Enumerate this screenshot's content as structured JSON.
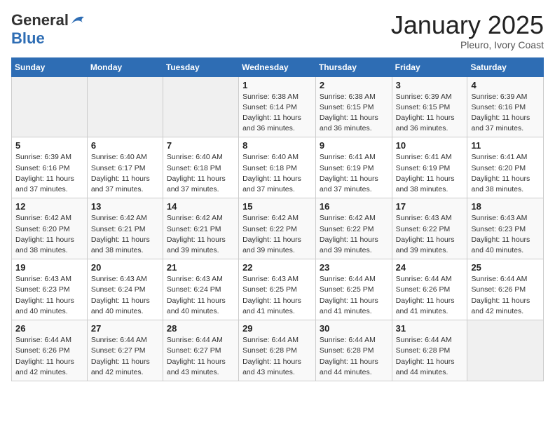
{
  "header": {
    "logo_general": "General",
    "logo_blue": "Blue",
    "month": "January 2025",
    "location": "Pleuro, Ivory Coast"
  },
  "weekdays": [
    "Sunday",
    "Monday",
    "Tuesday",
    "Wednesday",
    "Thursday",
    "Friday",
    "Saturday"
  ],
  "weeks": [
    [
      {
        "day": "",
        "info": ""
      },
      {
        "day": "",
        "info": ""
      },
      {
        "day": "",
        "info": ""
      },
      {
        "day": "1",
        "info": "Sunrise: 6:38 AM\nSunset: 6:14 PM\nDaylight: 11 hours and 36 minutes."
      },
      {
        "day": "2",
        "info": "Sunrise: 6:38 AM\nSunset: 6:15 PM\nDaylight: 11 hours and 36 minutes."
      },
      {
        "day": "3",
        "info": "Sunrise: 6:39 AM\nSunset: 6:15 PM\nDaylight: 11 hours and 36 minutes."
      },
      {
        "day": "4",
        "info": "Sunrise: 6:39 AM\nSunset: 6:16 PM\nDaylight: 11 hours and 37 minutes."
      }
    ],
    [
      {
        "day": "5",
        "info": "Sunrise: 6:39 AM\nSunset: 6:16 PM\nDaylight: 11 hours and 37 minutes."
      },
      {
        "day": "6",
        "info": "Sunrise: 6:40 AM\nSunset: 6:17 PM\nDaylight: 11 hours and 37 minutes."
      },
      {
        "day": "7",
        "info": "Sunrise: 6:40 AM\nSunset: 6:18 PM\nDaylight: 11 hours and 37 minutes."
      },
      {
        "day": "8",
        "info": "Sunrise: 6:40 AM\nSunset: 6:18 PM\nDaylight: 11 hours and 37 minutes."
      },
      {
        "day": "9",
        "info": "Sunrise: 6:41 AM\nSunset: 6:19 PM\nDaylight: 11 hours and 37 minutes."
      },
      {
        "day": "10",
        "info": "Sunrise: 6:41 AM\nSunset: 6:19 PM\nDaylight: 11 hours and 38 minutes."
      },
      {
        "day": "11",
        "info": "Sunrise: 6:41 AM\nSunset: 6:20 PM\nDaylight: 11 hours and 38 minutes."
      }
    ],
    [
      {
        "day": "12",
        "info": "Sunrise: 6:42 AM\nSunset: 6:20 PM\nDaylight: 11 hours and 38 minutes."
      },
      {
        "day": "13",
        "info": "Sunrise: 6:42 AM\nSunset: 6:21 PM\nDaylight: 11 hours and 38 minutes."
      },
      {
        "day": "14",
        "info": "Sunrise: 6:42 AM\nSunset: 6:21 PM\nDaylight: 11 hours and 39 minutes."
      },
      {
        "day": "15",
        "info": "Sunrise: 6:42 AM\nSunset: 6:22 PM\nDaylight: 11 hours and 39 minutes."
      },
      {
        "day": "16",
        "info": "Sunrise: 6:42 AM\nSunset: 6:22 PM\nDaylight: 11 hours and 39 minutes."
      },
      {
        "day": "17",
        "info": "Sunrise: 6:43 AM\nSunset: 6:22 PM\nDaylight: 11 hours and 39 minutes."
      },
      {
        "day": "18",
        "info": "Sunrise: 6:43 AM\nSunset: 6:23 PM\nDaylight: 11 hours and 40 minutes."
      }
    ],
    [
      {
        "day": "19",
        "info": "Sunrise: 6:43 AM\nSunset: 6:23 PM\nDaylight: 11 hours and 40 minutes."
      },
      {
        "day": "20",
        "info": "Sunrise: 6:43 AM\nSunset: 6:24 PM\nDaylight: 11 hours and 40 minutes."
      },
      {
        "day": "21",
        "info": "Sunrise: 6:43 AM\nSunset: 6:24 PM\nDaylight: 11 hours and 40 minutes."
      },
      {
        "day": "22",
        "info": "Sunrise: 6:43 AM\nSunset: 6:25 PM\nDaylight: 11 hours and 41 minutes."
      },
      {
        "day": "23",
        "info": "Sunrise: 6:44 AM\nSunset: 6:25 PM\nDaylight: 11 hours and 41 minutes."
      },
      {
        "day": "24",
        "info": "Sunrise: 6:44 AM\nSunset: 6:26 PM\nDaylight: 11 hours and 41 minutes."
      },
      {
        "day": "25",
        "info": "Sunrise: 6:44 AM\nSunset: 6:26 PM\nDaylight: 11 hours and 42 minutes."
      }
    ],
    [
      {
        "day": "26",
        "info": "Sunrise: 6:44 AM\nSunset: 6:26 PM\nDaylight: 11 hours and 42 minutes."
      },
      {
        "day": "27",
        "info": "Sunrise: 6:44 AM\nSunset: 6:27 PM\nDaylight: 11 hours and 42 minutes."
      },
      {
        "day": "28",
        "info": "Sunrise: 6:44 AM\nSunset: 6:27 PM\nDaylight: 11 hours and 43 minutes."
      },
      {
        "day": "29",
        "info": "Sunrise: 6:44 AM\nSunset: 6:28 PM\nDaylight: 11 hours and 43 minutes."
      },
      {
        "day": "30",
        "info": "Sunrise: 6:44 AM\nSunset: 6:28 PM\nDaylight: 11 hours and 44 minutes."
      },
      {
        "day": "31",
        "info": "Sunrise: 6:44 AM\nSunset: 6:28 PM\nDaylight: 11 hours and 44 minutes."
      },
      {
        "day": "",
        "info": ""
      }
    ]
  ]
}
